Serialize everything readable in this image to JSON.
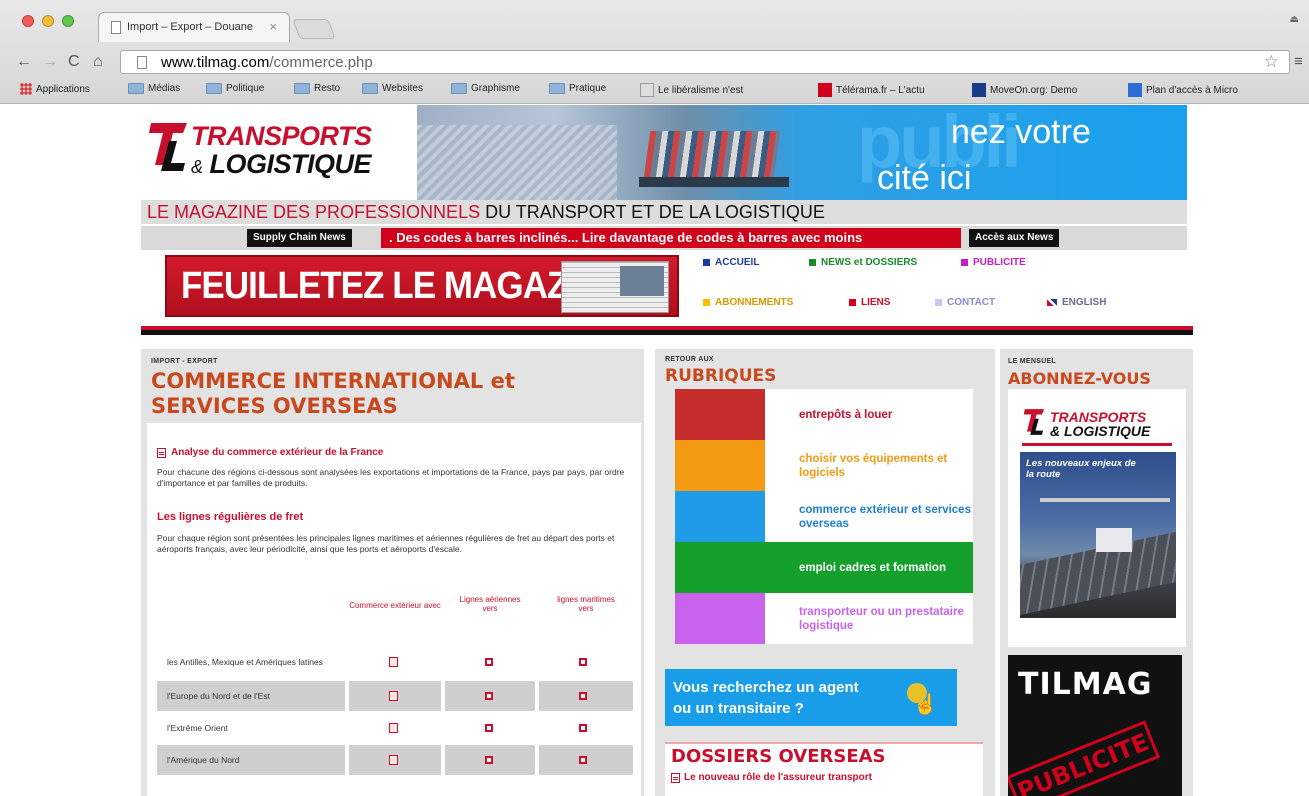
{
  "browser": {
    "tab_title": "Import – Export – Douane",
    "tab_close": "×",
    "url_host": "www.tilmag.com",
    "url_path": "/commerce.php",
    "bookmarks": [
      "Applications",
      "Médias",
      "Politique",
      "Resto",
      "Websites",
      "Graphisme",
      "Pratique",
      "Le libéralisme n'est",
      "Télérama.fr – L'actu",
      "MoveOn.org: Demo",
      "Plan d'accès à Micro"
    ]
  },
  "header": {
    "logo_line1": "TRANSPORTS",
    "logo_amp": "&",
    "logo_line2": "LOGISTIQUE",
    "banner_line1": "nez votre",
    "banner_line2": "cité ici",
    "banner_big": "publi",
    "tagline_red": "LE MAGAZINE DES PROFESSIONNELS",
    "tagline_dark": " DU TRANSPORT ET DE LA LOGISTIQUE",
    "ticker_left": "Supply Chain News",
    "ticker_text": ". Des codes à barres inclinés... Lire davantage de codes à barres avec moins",
    "ticker_right": "Accès aux News",
    "feuilletez": "FEUILLETEZ LE MAGAZINE"
  },
  "nav": {
    "accueil": "ACCUEIL",
    "news": "NEWS et DOSSIERS",
    "publicite": "PUBLICITE",
    "abonnements": "ABONNEMENTS",
    "liens": "LIENS",
    "contact": "CONTACT",
    "english": "ENGLISH",
    "colors": {
      "accueil": "#1d3b9a",
      "news": "#1a8a2b",
      "publicite": "#c41fc4",
      "abonnements": "#f2c200",
      "liens": "#d0021b",
      "contact": "#c8c8f0",
      "english": "#6b6b9b"
    }
  },
  "main": {
    "kicker": "IMPORT - EXPORT",
    "title_line1": "COMMERCE INTERNATIONAL et",
    "title_line2": "SERVICES OVERSEAS",
    "link1": "Analyse du commerce extérieur de la France",
    "para1": "Pour chacune des régions ci-dessous sont analysées les exportations et importations de la France, pays par pays, par ordre d'importance et par familles de produits.",
    "link2": "Les lignes régulières de fret",
    "para2": "Pour chaque région sont présentées les principales lignes maritimes et aériennes régulières de fret au départ des ports et aéroports français, avec leur périodicité, ainsi que les ports et aéroports d'escale.",
    "table": {
      "headers": [
        "Commerce extérieur avec",
        "Lignes aériennes vers",
        "lignes maritimes vers"
      ],
      "rows": [
        "les Antilles, Mexique et Amériques latines",
        "l'Europe du Nord et de l'Est",
        "l'Extrême Orient",
        "l'Amérique du Nord"
      ]
    }
  },
  "mid": {
    "kicker": "RETOUR AUX",
    "title": "RUBRIQUES",
    "rubriques": [
      {
        "label": "entrepôts à louer",
        "color": "#c62d2d",
        "text_color": "#c8102e",
        "bg": "#ffffff"
      },
      {
        "label": "choisir vos équipements et logiciels",
        "color": "#f39a12",
        "text_color": "#f39a12",
        "bg": "#ffffff"
      },
      {
        "label": "commerce extérieur et services overseas",
        "color": "#1f9be8",
        "text_color": "#1f7fd0",
        "bg": "#ffffff"
      },
      {
        "label": "emploi cadres et formation",
        "color": "#14a02a",
        "text_color": "#ffffff",
        "bg": "#14a02a"
      },
      {
        "label": "transporteur ou un prestataire logistique",
        "color": "#c862ec",
        "text_color": "#c862ec",
        "bg": "#ffffff"
      }
    ],
    "agent_line1": "Vous recherchez un agent",
    "agent_line2": "ou un transitaire ?",
    "dossiers_title": "DOSSIERS OVERSEAS",
    "dossiers_item": "Le nouveau rôle de l'assureur transport"
  },
  "right": {
    "kicker": "LE MENSUEL",
    "title": "ABONNEZ-VOUS",
    "mag_line1": "TRANSPORTS",
    "mag_line2": "& LOGISTIQUE",
    "cover_headline": "Les nouveaux enjeux de la route",
    "tilmag": "TILMAG",
    "stamp": "PUBLICITE"
  }
}
